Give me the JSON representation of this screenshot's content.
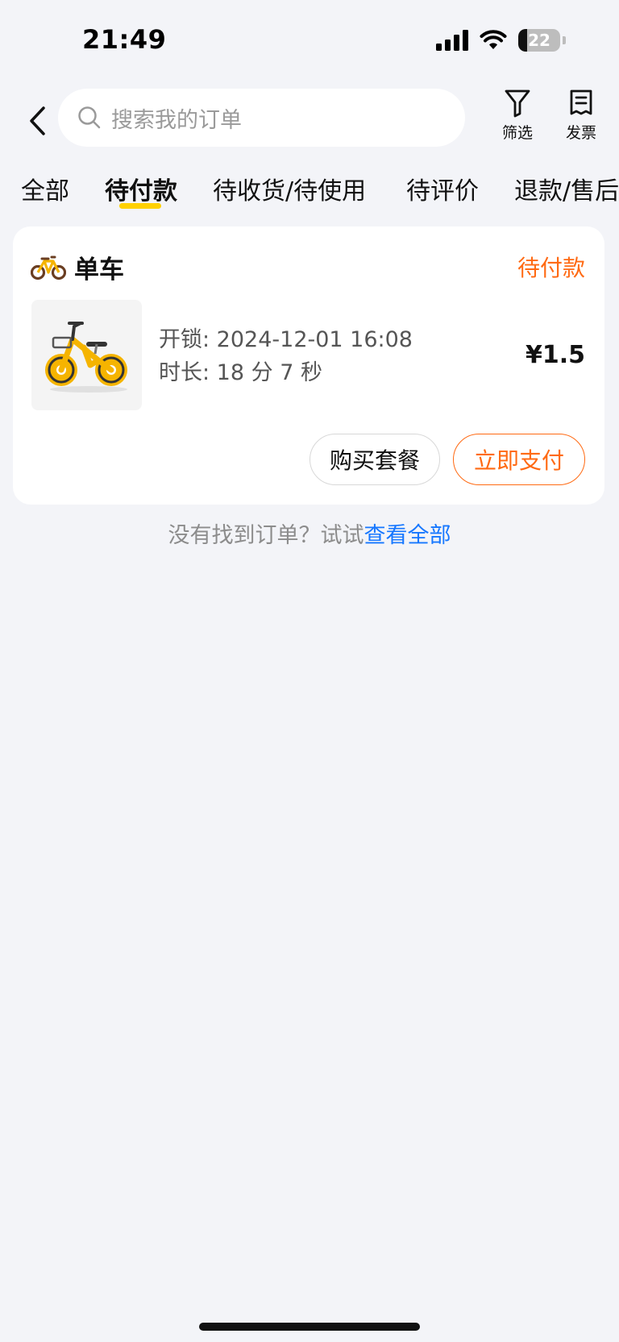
{
  "status_bar": {
    "time": "21:49",
    "battery": "22",
    "battery_level": 0.22,
    "icons": [
      "signal-icon",
      "wifi-icon",
      "battery-icon"
    ]
  },
  "header": {
    "search_placeholder": "搜索我的订单",
    "filter_label": "筛选",
    "invoice_label": "发票"
  },
  "tabs": [
    {
      "label": "全部",
      "active": false
    },
    {
      "label": "待付款",
      "active": true
    },
    {
      "label": "待收货/待使用",
      "active": false
    },
    {
      "label": "待评价",
      "active": false
    },
    {
      "label": "退款/售后",
      "active": false
    }
  ],
  "order": {
    "category": "单车",
    "status": "待付款",
    "unlock": "开锁: 2024-12-01 16:08",
    "duration": "时长: 18 分 7 秒",
    "price": "¥1.5",
    "buttons": {
      "buy_package": "购买套餐",
      "pay_now": "立即支付"
    }
  },
  "footer": {
    "hint": "没有找到订单？试试",
    "link": "查看全部"
  },
  "colors": {
    "accent_orange": "#ff6a13",
    "tab_indicator": "#ffd100",
    "link_blue": "#1677ff",
    "background": "#f3f4f8"
  }
}
